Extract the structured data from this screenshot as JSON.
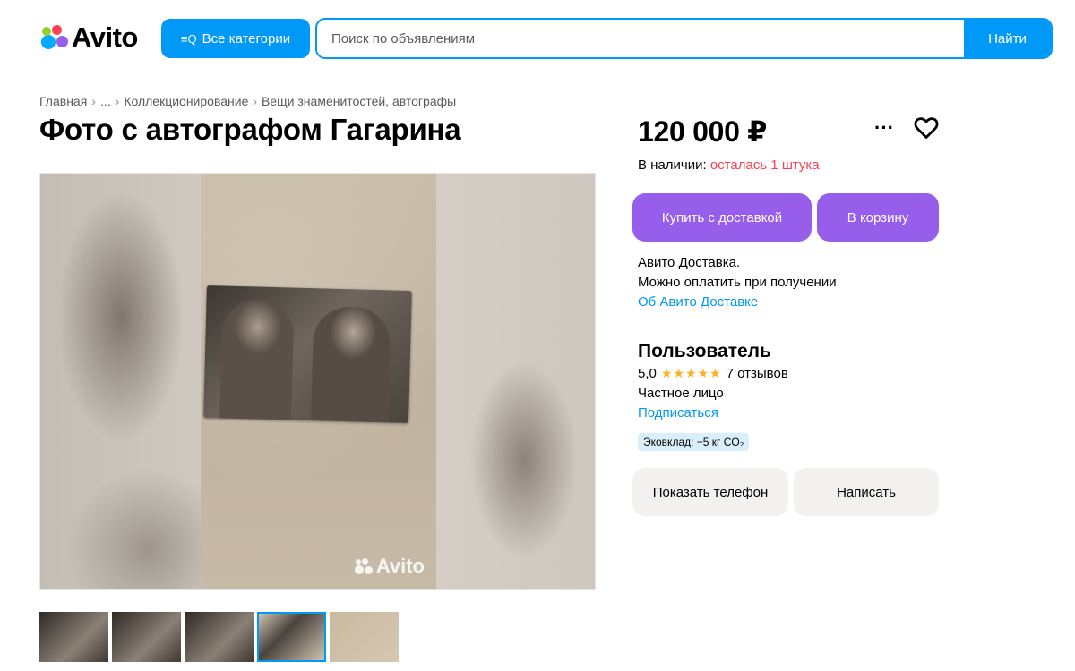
{
  "header": {
    "logo_text": "Avito",
    "categories_button": "Все категории",
    "search_placeholder": "Поиск по объявлениям",
    "search_button": "Найти"
  },
  "breadcrumb": [
    "Главная",
    "...",
    "Коллекционирование",
    "Вещи знаменитостей, автографы"
  ],
  "listing": {
    "title": "Фото с автографом Гагарина",
    "watermark": "Avito",
    "thumbnail_count": 5,
    "active_thumbnail_index": 3
  },
  "sidebar": {
    "price": "120 000 ₽",
    "stock_label": "В наличии:",
    "stock_value": "осталась 1 штука",
    "buy_button": "Купить с доставкой",
    "cart_button": "В корзину",
    "delivery_line1": "Авито Доставка.",
    "delivery_line2": "Можно оплатить при получении",
    "delivery_link": "Об Авито Доставке",
    "seller_name": "Пользователь",
    "rating_value": "5,0",
    "rating_stars": "★★★★★",
    "reviews": "7 отзывов",
    "seller_type": "Частное лицо",
    "subscribe_link": "Подписаться",
    "eco_badge": "Эковклад: −5 кг CO₂",
    "phone_button": "Показать телефон",
    "write_button": "Написать"
  },
  "colors": {
    "accent_blue": "#0099f7",
    "purple": "#965eeb",
    "red": "#ff4053",
    "star": "#ffb021"
  },
  "icons": [
    "avito-logo-icon",
    "categories-search-icon",
    "more-icon",
    "heart-icon",
    "star-icon"
  ]
}
